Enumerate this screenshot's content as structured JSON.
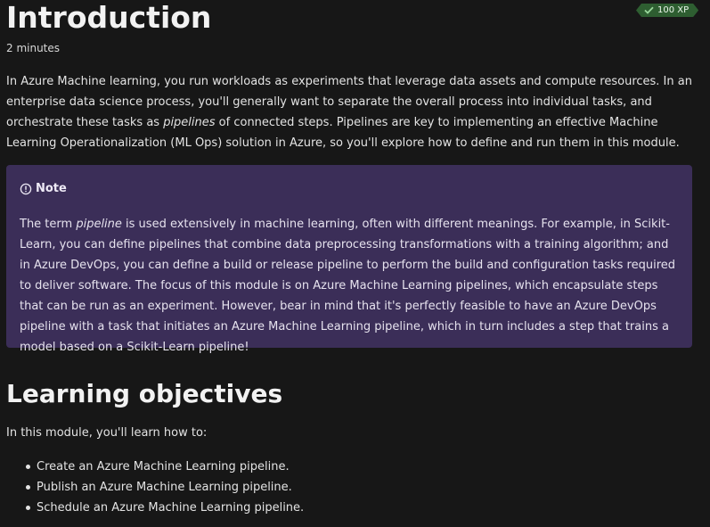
{
  "header": {
    "title": "Introduction",
    "duration": "2 minutes",
    "xp_badge": "100 XP"
  },
  "intro": {
    "before": "In Azure Machine learning, you run workloads as experiments that leverage data assets and compute resources. In an enterprise data science process, you'll generally want to separate the overall process into individual tasks, and orchestrate these tasks as ",
    "emphasis": "pipelines",
    "after": " of connected steps. Pipelines are key to implementing an effective Machine Learning Operationalization (ML Ops) solution in Azure, so you'll explore how to define and run them in this module."
  },
  "note": {
    "label": "Note",
    "before": "The term ",
    "emphasis": "pipeline",
    "after": " is used extensively in machine learning, often with different meanings. For example, in Scikit-Learn, you can define pipelines that combine data preprocessing transformations with a training algorithm; and in Azure DevOps, you can define a build or release pipeline to perform the build and configuration tasks required to deliver software. The focus of this module is on Azure Machine Learning pipelines, which encapsulate steps that can be run as an experiment. However, bear in mind that it's perfectly feasible to have an Azure DevOps pipeline with a task that initiates an Azure Machine Learning pipeline, which in turn includes a step that trains a model based on a Scikit-Learn pipeline!"
  },
  "objectives": {
    "heading": "Learning objectives",
    "lead": "In this module, you'll learn how to:",
    "items": [
      "Create an Azure Machine Learning pipeline.",
      "Publish an Azure Machine Learning pipeline.",
      "Schedule an Azure Machine Learning pipeline."
    ]
  },
  "colors": {
    "background": "#171717",
    "note_background": "#3b2e58",
    "badge_background": "#2e5e31"
  },
  "icons": {
    "badge": "checkmark-icon",
    "note": "info-circle-icon"
  }
}
